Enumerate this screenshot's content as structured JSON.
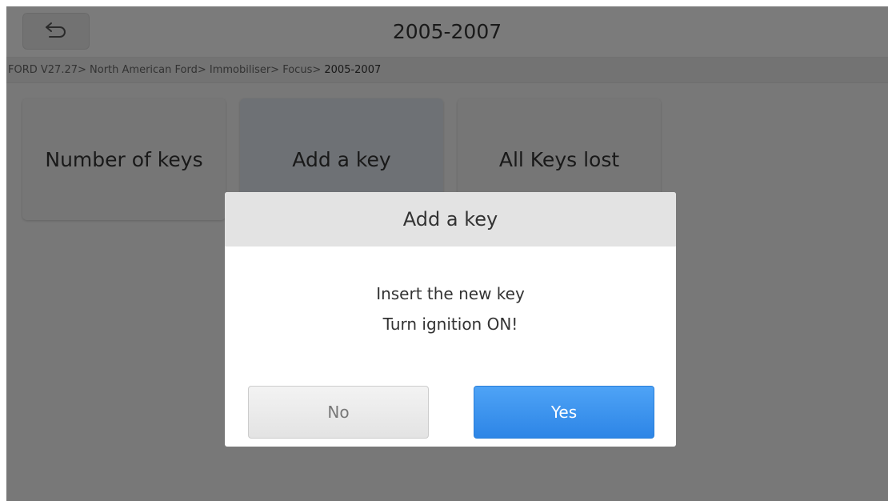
{
  "header": {
    "title": "2005-2007",
    "back_icon": "return-arrow-icon"
  },
  "breadcrumb": {
    "path": "FORD V27.27> North American Ford> Immobiliser> Focus> ",
    "current": "2005-2007"
  },
  "functions": [
    {
      "label": "Number of keys",
      "selected": false
    },
    {
      "label": "Add a key",
      "selected": true
    },
    {
      "label": "All Keys lost",
      "selected": false
    }
  ],
  "dialog": {
    "title": "Add a key",
    "lines": [
      "Insert the new key",
      "Turn ignition ON!"
    ],
    "no_label": "No",
    "yes_label": "Yes"
  },
  "colors": {
    "accent_button": "#2d85e6",
    "overlay": "#000000"
  }
}
